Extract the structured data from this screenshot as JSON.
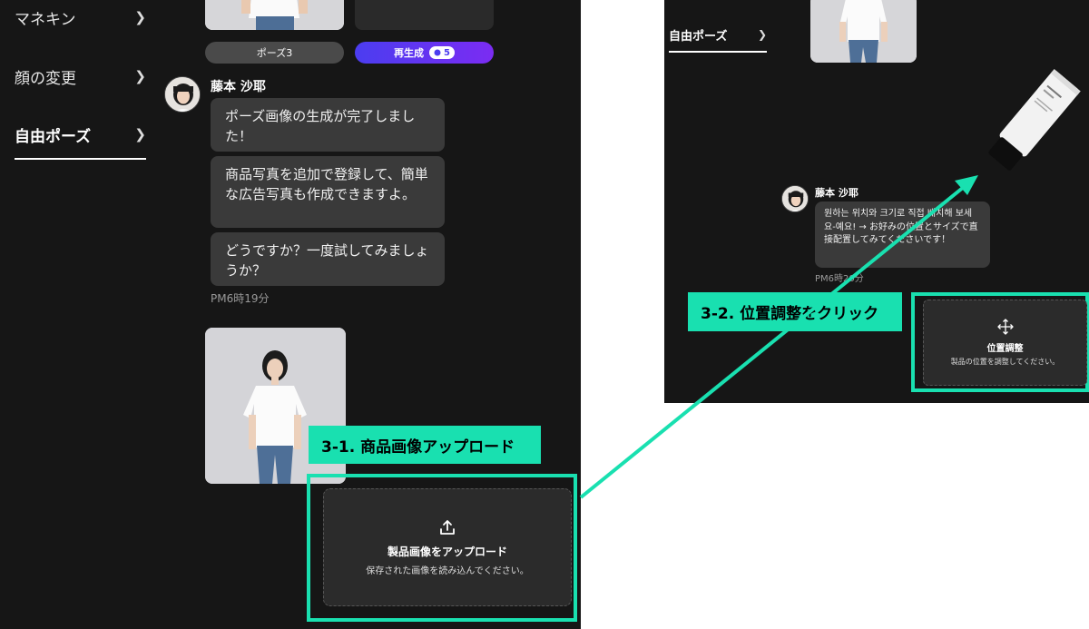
{
  "left_panel": {
    "sidebar": {
      "items": [
        {
          "label": "マネキン"
        },
        {
          "label": "顔の変更"
        },
        {
          "label": "自由ポーズ"
        }
      ]
    },
    "pose_button": "ポーズ3",
    "regen_button": "再生成",
    "regen_credits": "5",
    "message": {
      "sender": "藤本 沙耶",
      "bubbles": [
        "ポーズ画像の生成が完了しました！",
        "商品写真を追加で登録して、簡単な広告写真も作成できますよ。",
        "どうですか？一度試してみましょうか？"
      ],
      "time": "PM6時19分"
    },
    "upload": {
      "title": "製品画像をアップロード",
      "subtitle": "保存された画像を読み込んでください。"
    },
    "step_label": "3-1. 商品画像アップロード"
  },
  "right_panel": {
    "sidebar_item": "自由ポーズ",
    "message": {
      "sender": "藤本 沙耶",
      "text": "원하는 위치와 크기로 직접 배치해 보세요-예요! → お好みの位置とサイズで直接配置してみてくださいです！",
      "time": "PM6時20分"
    },
    "adjust": {
      "title": "位置調整",
      "subtitle": "製品の位置を調整してください。"
    },
    "step_label": "3-2. 位置調整をクリック"
  },
  "colors": {
    "highlight": "#19e0b0",
    "panel_bg": "#161616",
    "bubble_bg": "#3a3a3a",
    "gradient_start": "#4b3df0",
    "gradient_end": "#7b2cf2"
  }
}
